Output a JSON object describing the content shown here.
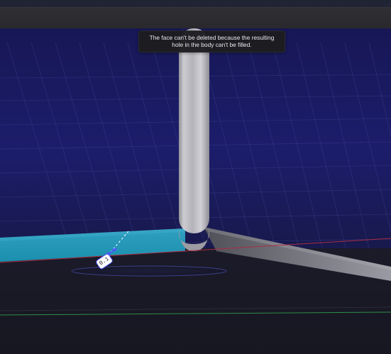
{
  "tooltip": {
    "message": "The face can't be deleted because the resulting hole in the body can't be filled."
  },
  "dimension": {
    "value": "0.1",
    "color": "#3e49ea"
  },
  "colors": {
    "sky": "#1c1c68",
    "horizon": "#121324",
    "ground": "#1b1b26",
    "accent_face": "#2bb0cf",
    "grid": "#4d4fa2",
    "red_axis": "#aa2c42",
    "green_axis": "#2e8e45",
    "blue_indicator": "#4b57ff"
  },
  "icons": {
    "handle": "dimension-handle-icon"
  }
}
